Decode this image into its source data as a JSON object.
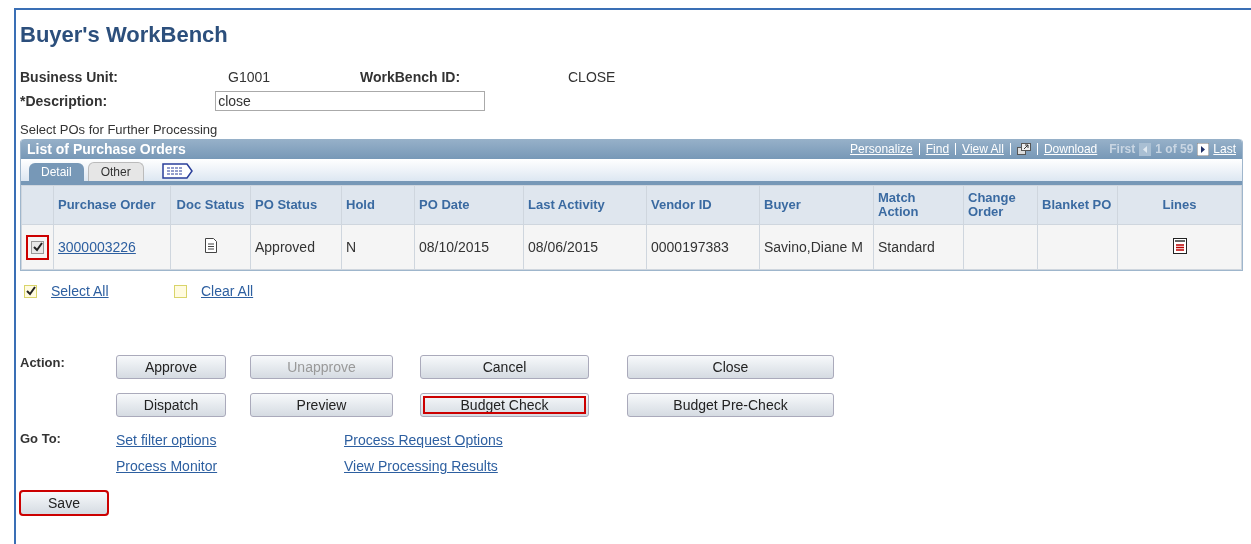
{
  "page_title": "Buyer's WorkBench",
  "header_fields": [
    {
      "label": "Business Unit:",
      "value": "G1001"
    },
    {
      "label": "WorkBench ID:",
      "value": "CLOSE"
    }
  ],
  "description": {
    "label": "*Description:",
    "value": "close"
  },
  "instruction": "Select POs for Further Processing",
  "grid": {
    "title": "List of Purchase Orders",
    "toolbar_links": [
      "Personalize",
      "Find",
      "View All",
      "Download"
    ],
    "first": "First",
    "range": "1 of 59",
    "last": "Last",
    "tabs": [
      {
        "label": "Detail",
        "selected": true
      },
      {
        "label": "Other",
        "selected": false
      }
    ],
    "columns": [
      "Purchase Order",
      "Doc Status",
      "PO Status",
      "Hold",
      "PO Date",
      "Last Activity",
      "Vendor ID",
      "Buyer",
      "Match Action",
      "Change Order",
      "Blanket PO",
      "Lines"
    ],
    "rows": [
      {
        "checked": true,
        "highlighted": true,
        "po": "3000003226",
        "po_status": "Approved",
        "hold": "N",
        "po_date": "08/10/2015",
        "last_activity": "08/06/2015",
        "vendor_id": "0000197383",
        "buyer": "Savino,Diane M",
        "match_action": "Standard"
      }
    ]
  },
  "select_all": {
    "label": "Select All",
    "checked": true
  },
  "clear_all": {
    "label": "Clear All",
    "checked": false
  },
  "action_label": "Action:",
  "actions": [
    {
      "label": "Approve",
      "disabled": false,
      "highlighted": false
    },
    {
      "label": "Unapprove",
      "disabled": true,
      "highlighted": false
    },
    {
      "label": "Cancel",
      "disabled": false,
      "highlighted": false
    },
    {
      "label": "Close",
      "disabled": false,
      "highlighted": false
    },
    {
      "label": "Dispatch",
      "disabled": false,
      "highlighted": false
    },
    {
      "label": "Preview",
      "disabled": false,
      "highlighted": false
    },
    {
      "label": "Budget Check",
      "disabled": false,
      "highlighted": true
    },
    {
      "label": "Budget Pre-Check",
      "disabled": false,
      "highlighted": false
    }
  ],
  "goto_label": "Go To:",
  "goto_links": [
    "Set filter options",
    "Process Request Options",
    "Process Monitor",
    "View Processing Results"
  ],
  "save": {
    "label": "Save",
    "highlighted": true
  }
}
